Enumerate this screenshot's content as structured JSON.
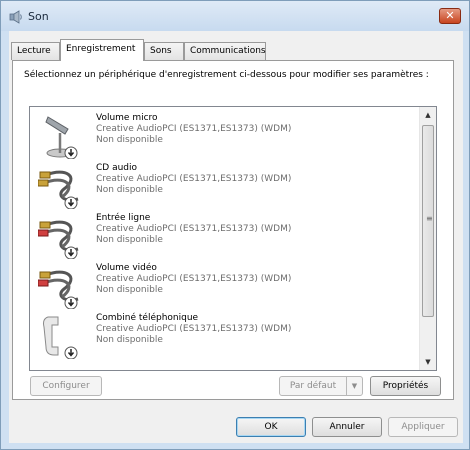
{
  "window": {
    "title": "Son",
    "close_label": "✕"
  },
  "tabs": [
    {
      "label": "Lecture",
      "active": false
    },
    {
      "label": "Enregistrement",
      "active": true
    },
    {
      "label": "Sons",
      "active": false
    },
    {
      "label": "Communications",
      "active": false
    }
  ],
  "instruction": "Sélectionnez un périphérique d'enregistrement ci-dessous pour modifier ses paramètres :",
  "devices": [
    {
      "name": "Volume micro",
      "driver": "Creative AudioPCI (ES1371,ES1373) (WDM)",
      "status": "Non disponible",
      "icon": "microphone-icon"
    },
    {
      "name": "CD audio",
      "driver": "Creative AudioPCI (ES1371,ES1373) (WDM)",
      "status": "Non disponible",
      "icon": "rca-cable-icon"
    },
    {
      "name": "Entrée ligne",
      "driver": "Creative AudioPCI (ES1371,ES1373) (WDM)",
      "status": "Non disponible",
      "icon": "rca-cable-icon"
    },
    {
      "name": "Volume vidéo",
      "driver": "Creative AudioPCI (ES1371,ES1373) (WDM)",
      "status": "Non disponible",
      "icon": "rca-cable-icon"
    },
    {
      "name": "Combiné téléphonique",
      "driver": "Creative AudioPCI (ES1371,ES1373) (WDM)",
      "status": "Non disponible",
      "icon": "telephone-handset-icon"
    }
  ],
  "scrollbar": {
    "up": "▲",
    "down": "▼",
    "grip": "≡"
  },
  "buttons": {
    "configure": "Configurer",
    "set_default": "Par défaut",
    "set_default_arrow": "▼",
    "properties": "Propriétés",
    "ok": "OK",
    "cancel": "Annuler",
    "apply": "Appliquer"
  },
  "colors": {
    "frame": "#cfe0f2",
    "close_button": "#c8451f",
    "disabled_text": "#8d8d8d",
    "secondary_text": "#6d6d6d"
  }
}
